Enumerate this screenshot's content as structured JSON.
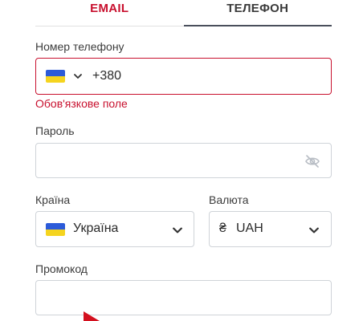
{
  "tabs": {
    "email_label": "EMAIL",
    "phone_label": "ТЕЛЕФОН",
    "active": "phone"
  },
  "phone": {
    "label": "Номер телефону",
    "country_flag": "ukraine-flag-icon",
    "prefix": "+380",
    "error": "Обов'язкове поле"
  },
  "password": {
    "label": "Пароль",
    "value": "",
    "visibility_icon": "eye-off-icon"
  },
  "country": {
    "label": "Країна",
    "flag": "ukraine-flag-icon",
    "value": "Україна"
  },
  "currency": {
    "label": "Валюта",
    "symbol": "₴",
    "value": "UAH"
  },
  "promo": {
    "label": "Промокод",
    "value": ""
  },
  "colors": {
    "accent_red": "#c8102e",
    "tab_underline": "#4a4f5c",
    "border": "#cfd3d8",
    "flag_blue": "#2c5bd9",
    "flag_yellow": "#f5d41f"
  }
}
